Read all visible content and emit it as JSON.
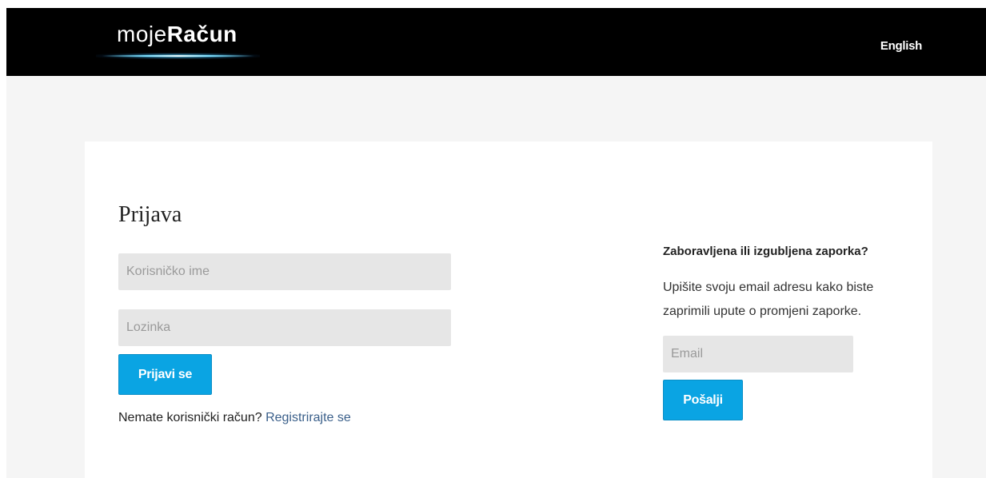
{
  "header": {
    "logo_light": "moje",
    "logo_bold": "Račun",
    "language_link": "English"
  },
  "login": {
    "title": "Prijava",
    "username_placeholder": "Korisničko ime",
    "password_placeholder": "Lozinka",
    "submit_label": "Prijavi se",
    "no_account_text": "Nemate korisnički račun?",
    "register_link": "Registrirajte se"
  },
  "forgot_password": {
    "title": "Zaboravljena ili izgubljena zaporka?",
    "description": "Upišite svoju email adresu kako biste zaprimili upute o promjeni zaporke.",
    "email_placeholder": "Email",
    "submit_label": "Pošalji"
  },
  "colors": {
    "header_bg": "#000000",
    "page_bg": "#f5f5f5",
    "button_bg": "#0aa4e3",
    "link": "#3a5f8a",
    "input_bg": "#e6e6e6"
  }
}
